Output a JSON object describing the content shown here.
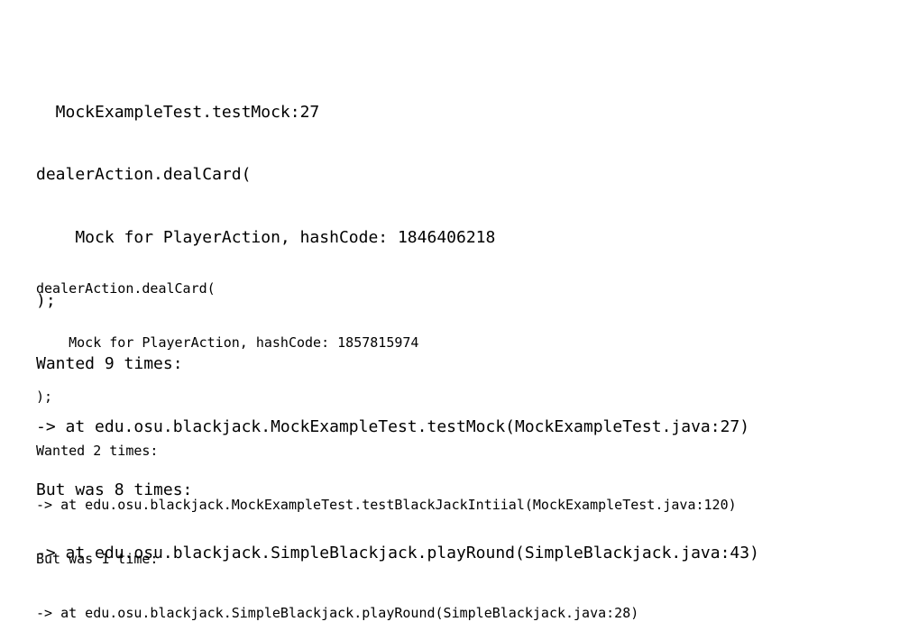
{
  "console": {
    "block1": [
      "  MockExampleTest.testMock:27",
      "dealerAction.dealCard(",
      "    Mock for PlayerAction, hashCode: 1846406218",
      ");",
      "Wanted 9 times:",
      "-> at edu.osu.blackjack.MockExampleTest.testMock(MockExampleTest.java:27)",
      "But was 8 times:",
      "-> at edu.osu.blackjack.SimpleBlackjack.playRound(SimpleBlackjack.java:43)"
    ],
    "block2": [
      "dealerAction.dealCard(",
      "    Mock for PlayerAction, hashCode: 1857815974",
      ");",
      "Wanted 2 times:",
      "-> at edu.osu.blackjack.MockExampleTest.testBlackJackIntiial(MockExampleTest.java:120)",
      "But was 1 time:",
      "-> at edu.osu.blackjack.SimpleBlackjack.playRound(SimpleBlackjack.java:28)"
    ]
  }
}
